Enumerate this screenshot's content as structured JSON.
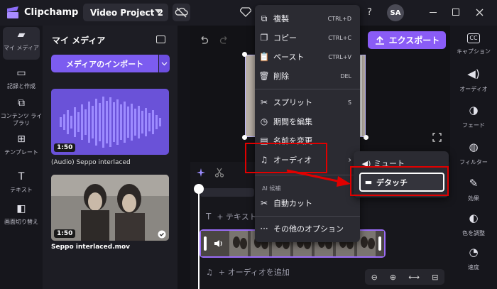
{
  "app": {
    "name": "Clipchamp",
    "project": "Video Project 2",
    "avatar": "SA",
    "help": "?"
  },
  "left_rail": [
    {
      "label": "マイ メディア",
      "icon": "folder-icon"
    },
    {
      "label": "記録と作成",
      "icon": "camera-icon"
    },
    {
      "label": "コンテンツ ライブラリ",
      "icon": "library-icon"
    },
    {
      "label": "テンプレート",
      "icon": "template-icon"
    },
    {
      "label": "テキスト",
      "icon": "text-icon"
    },
    {
      "label": "画面切り替え",
      "icon": "transition-icon"
    }
  ],
  "media": {
    "title": "マイ メディア",
    "import_label": "メディアのインポート",
    "items": [
      {
        "name": "(Audio) Seppo interlaced",
        "duration": "1:50"
      },
      {
        "name": "Seppo interlaced.mov",
        "duration": "1:50"
      }
    ]
  },
  "toolbar": {
    "export_label": "エクスポート"
  },
  "timeline": {
    "text_track": "+ テキスト",
    "audio_track": "+ オーディオを追加"
  },
  "context_menu": {
    "items": [
      {
        "label": "複製",
        "shortcut": "CTRL+D",
        "icon": "duplicate-icon"
      },
      {
        "label": "コピー",
        "shortcut": "CTRL+C",
        "icon": "copy-icon"
      },
      {
        "label": "ペースト",
        "shortcut": "CTRL+V",
        "icon": "paste-icon"
      },
      {
        "label": "削除",
        "shortcut": "DEL",
        "icon": "trash-icon"
      },
      {
        "label": "スプリット",
        "shortcut": "S",
        "icon": "scissors-icon"
      },
      {
        "label": "期間を編集",
        "shortcut": "",
        "icon": "clock-icon"
      },
      {
        "label": "名前を変更",
        "shortcut": "",
        "icon": "rename-icon"
      },
      {
        "label": "オーディオ",
        "shortcut": "",
        "icon": "music-note-icon"
      }
    ],
    "section_label": "AI 候補",
    "auto_cut": "自動カット",
    "more_options": "その他のオプション"
  },
  "submenu": {
    "mute": "ミュート",
    "detach": "デタッチ"
  },
  "right_rail": [
    {
      "label": "キャプション",
      "icon": "cc-icon"
    },
    {
      "label": "オーディオ",
      "icon": "speaker-icon"
    },
    {
      "label": "フェード",
      "icon": "fade-icon"
    },
    {
      "label": "フィルター",
      "icon": "filter-icon"
    },
    {
      "label": "効果",
      "icon": "effects-icon"
    },
    {
      "label": "色を調整",
      "icon": "color-icon"
    },
    {
      "label": "速度",
      "icon": "speed-icon"
    }
  ],
  "colors": {
    "accent": "#7c5cf0",
    "highlight": "#e00000"
  }
}
